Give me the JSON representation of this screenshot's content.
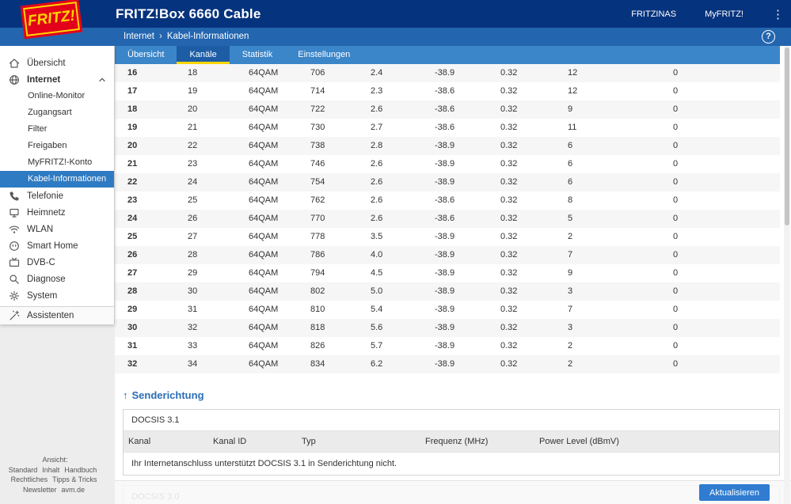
{
  "header": {
    "logo_text": "FRITZ!",
    "title": "FRITZ!Box 6660 Cable",
    "nav_user": "FRITZINAS",
    "nav_myfritz": "MyFRITZ!"
  },
  "breadcrumb": {
    "section": "Internet",
    "separator": "›",
    "page": "Kabel-Informationen",
    "help": "?"
  },
  "tabs": {
    "items": [
      {
        "label": "Übersicht"
      },
      {
        "label": "Kanäle",
        "active": true
      },
      {
        "label": "Statistik"
      },
      {
        "label": "Einstellungen"
      }
    ]
  },
  "sidebar": {
    "items": [
      {
        "label": "Übersicht",
        "icon": "home-icon"
      },
      {
        "label": "Internet",
        "icon": "globe-icon",
        "expanded": true
      },
      {
        "label": "Telefonie",
        "icon": "phone-icon"
      },
      {
        "label": "Heimnetz",
        "icon": "network-icon"
      },
      {
        "label": "WLAN",
        "icon": "wifi-icon"
      },
      {
        "label": "Smart Home",
        "icon": "smarthome-icon"
      },
      {
        "label": "DVB-C",
        "icon": "tv-icon"
      },
      {
        "label": "Diagnose",
        "icon": "diagnose-icon"
      },
      {
        "label": "System",
        "icon": "system-icon"
      },
      {
        "label": "Assistenten",
        "icon": "wand-icon"
      }
    ],
    "internet_children": [
      {
        "label": "Online-Monitor"
      },
      {
        "label": "Zugangsart"
      },
      {
        "label": "Filter"
      },
      {
        "label": "Freigaben"
      },
      {
        "label": "MyFRITZ!-Konto"
      },
      {
        "label": "Kabel-Informationen",
        "active": true
      }
    ],
    "footer_links": [
      "Ansicht: Standard",
      "Inhalt",
      "Handbuch",
      "Rechtliches",
      "Tipps & Tricks",
      "Newsletter",
      "avm.de"
    ]
  },
  "channel_table": {
    "rows": [
      [
        "16",
        "18",
        "64QAM",
        "706",
        "2.4",
        "-38.9",
        "0.32",
        "12",
        "0"
      ],
      [
        "17",
        "19",
        "64QAM",
        "714",
        "2.3",
        "-38.6",
        "0.32",
        "12",
        "0"
      ],
      [
        "18",
        "20",
        "64QAM",
        "722",
        "2.6",
        "-38.6",
        "0.32",
        "9",
        "0"
      ],
      [
        "19",
        "21",
        "64QAM",
        "730",
        "2.7",
        "-38.6",
        "0.32",
        "11",
        "0"
      ],
      [
        "20",
        "22",
        "64QAM",
        "738",
        "2.8",
        "-38.9",
        "0.32",
        "6",
        "0"
      ],
      [
        "21",
        "23",
        "64QAM",
        "746",
        "2.6",
        "-38.9",
        "0.32",
        "6",
        "0"
      ],
      [
        "22",
        "24",
        "64QAM",
        "754",
        "2.6",
        "-38.9",
        "0.32",
        "6",
        "0"
      ],
      [
        "23",
        "25",
        "64QAM",
        "762",
        "2.6",
        "-38.6",
        "0.32",
        "8",
        "0"
      ],
      [
        "24",
        "26",
        "64QAM",
        "770",
        "2.6",
        "-38.6",
        "0.32",
        "5",
        "0"
      ],
      [
        "25",
        "27",
        "64QAM",
        "778",
        "3.5",
        "-38.9",
        "0.32",
        "2",
        "0"
      ],
      [
        "26",
        "28",
        "64QAM",
        "786",
        "4.0",
        "-38.9",
        "0.32",
        "7",
        "0"
      ],
      [
        "27",
        "29",
        "64QAM",
        "794",
        "4.5",
        "-38.9",
        "0.32",
        "9",
        "0"
      ],
      [
        "28",
        "30",
        "64QAM",
        "802",
        "5.0",
        "-38.9",
        "0.32",
        "3",
        "0"
      ],
      [
        "29",
        "31",
        "64QAM",
        "810",
        "5.4",
        "-38.9",
        "0.32",
        "7",
        "0"
      ],
      [
        "30",
        "32",
        "64QAM",
        "818",
        "5.6",
        "-38.9",
        "0.32",
        "3",
        "0"
      ],
      [
        "31",
        "33",
        "64QAM",
        "826",
        "5.7",
        "-38.9",
        "0.32",
        "2",
        "0"
      ],
      [
        "32",
        "34",
        "64QAM",
        "834",
        "6.2",
        "-38.9",
        "0.32",
        "2",
        "0"
      ]
    ]
  },
  "senderichtung": {
    "arrow": "↑",
    "title": "Senderichtung",
    "docsis31": {
      "title": "DOCSIS 3.1",
      "headers": [
        "Kanal",
        "Kanal ID",
        "Typ",
        "Frequenz (MHz)",
        "Power Level (dBmV)"
      ],
      "message": "Ihr Internetanschluss unterstützt DOCSIS 3.1 in Senderichtung nicht."
    },
    "docsis30": {
      "title": "DOCSIS 3.0"
    }
  },
  "actions": {
    "refresh": "Aktualisieren"
  },
  "colors": {
    "header_blue": "#06337d",
    "breadcrumb_blue": "#2365af",
    "tabbar_blue": "#3b85c9",
    "tab_active_blue": "#1d5da6",
    "accent_yellow": "#ffd500",
    "selected_blue": "#2f7bc3",
    "brand_red": "#e2001a",
    "heading_blue": "#2a6db6",
    "button_blue": "#2f7cd0"
  }
}
